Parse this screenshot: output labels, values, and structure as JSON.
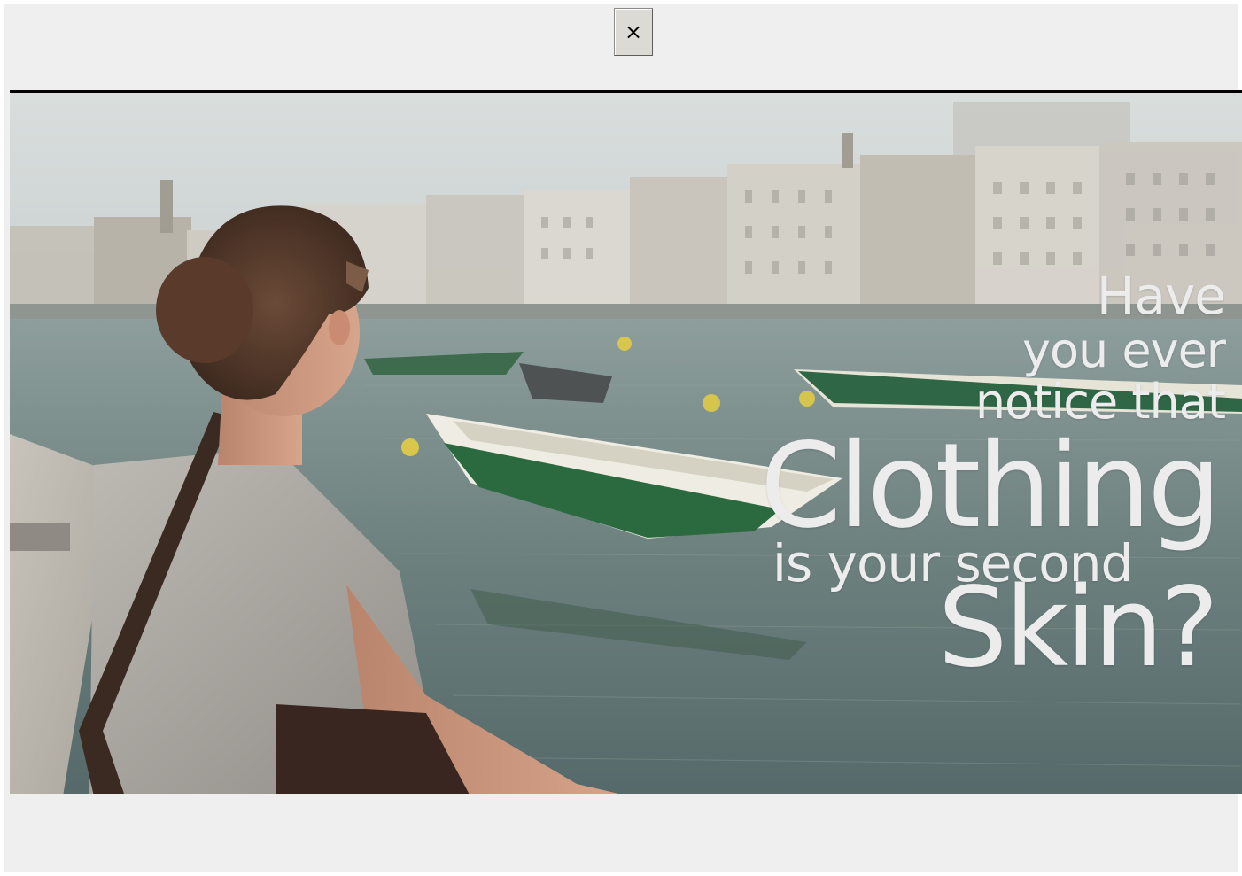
{
  "close_button": {
    "label": "×",
    "icon": "close-icon"
  },
  "video": {
    "overlay_lines": [
      "Have",
      "you ever",
      "notice that",
      "Clothing",
      "is your second",
      "Skin?"
    ]
  },
  "colors": {
    "background": "#efefef",
    "overlay_text": "#ececec",
    "water": "#6f8582",
    "sky": "#dfe3e1"
  }
}
